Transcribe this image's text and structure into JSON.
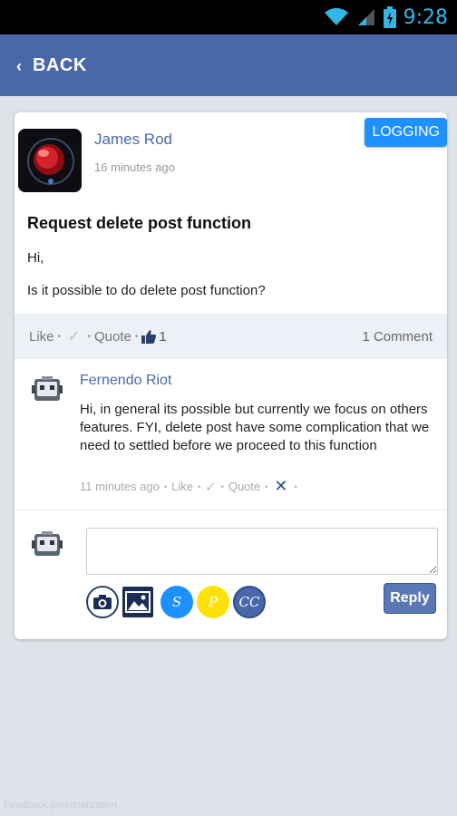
{
  "status_bar": {
    "time": "9:28"
  },
  "header": {
    "back_label": "BACK"
  },
  "post": {
    "author": "James Rod",
    "time": "16 minutes ago",
    "tag": "LOGGING",
    "title": "Request delete post function",
    "body_lines": [
      "Hi,",
      "Is it possible to do delete post function?"
    ],
    "actions": {
      "like": "Like",
      "quote": "Quote",
      "likes_count": "1",
      "comments": "1 Comment"
    }
  },
  "comment": {
    "author": "Fernendo Riot",
    "text": "Hi, in general its possible but currently we focus on others features. FYI, delete post have some complication that we need to settled before we proceed to this function",
    "time": "11 minutes ago",
    "like": "Like",
    "quote": "Quote"
  },
  "reply": {
    "input_value": "",
    "tools": {
      "s_label": "S",
      "p_label": "P",
      "cc_label": "CC"
    },
    "button_label": "Reply"
  },
  "footer": {
    "watermark": "Feedback personalization"
  },
  "colors": {
    "header_bg": "#4a67aa",
    "tag_bg": "#1e90ff",
    "link": "#4a67aa"
  }
}
